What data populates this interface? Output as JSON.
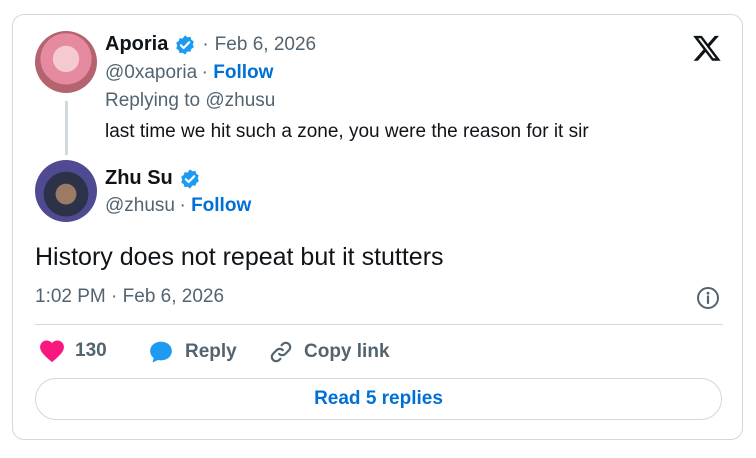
{
  "reply_to": {
    "name": "Aporia",
    "date": "Feb 6, 2026",
    "handle": "@0xaporia",
    "follow_label": "Follow",
    "replying_prefix": "Replying to",
    "replying_handle": "@zhusu",
    "text": "last time we hit such a zone, you were the reason for it sir"
  },
  "tweet": {
    "name": "Zhu Su",
    "handle": "@zhusu",
    "follow_label": "Follow",
    "text": "History does not repeat but it stutters",
    "timestamp": "1:02 PM · Feb 6, 2026"
  },
  "actions": {
    "like_count": "130",
    "reply_label": "Reply",
    "copy_link_label": "Copy link"
  },
  "read_replies_label": "Read 5 replies",
  "colors": {
    "accent": "#006fd6",
    "verified": "#1d9bf0",
    "like": "#f91880",
    "muted_text": "#536471",
    "border": "#cfd9de"
  },
  "icons": [
    "verified-badge-icon",
    "x-logo-icon",
    "info-icon",
    "heart-icon",
    "reply-bubble-icon",
    "link-icon"
  ]
}
